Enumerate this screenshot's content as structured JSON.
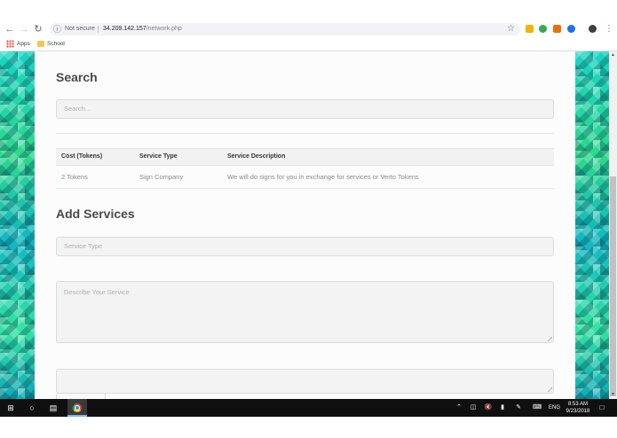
{
  "browser": {
    "security_label": "Not secure",
    "url_host": "34.209.142.157",
    "url_path": "/network.php",
    "bookmarks": [
      {
        "label": "Apps",
        "icon": "apps-grid-icon"
      },
      {
        "label": "School",
        "icon": "folder-icon"
      }
    ]
  },
  "search_section": {
    "heading": "Search",
    "search_placeholder": "Search..."
  },
  "table": {
    "columns": [
      "Cost (Tokens)",
      "Service Type",
      "Service Description"
    ],
    "rows": [
      [
        "2 Tokens",
        "Sign Company",
        "We will do signs for you in exchange for services or Verto Tokens"
      ]
    ]
  },
  "add_section": {
    "heading": "Add Services",
    "service_type_placeholder": "Service Type",
    "description_placeholder": "Describe Your Service"
  },
  "taskbar": {
    "language": "ENG",
    "time": "8:53 AM",
    "date": "9/23/2018"
  },
  "colors": {
    "side_panel_gradient": [
      "#19d3c5",
      "#2fd88a",
      "#11a8b8"
    ],
    "heading_text": "#4a4a4a",
    "field_background": "#f3f3f3"
  }
}
